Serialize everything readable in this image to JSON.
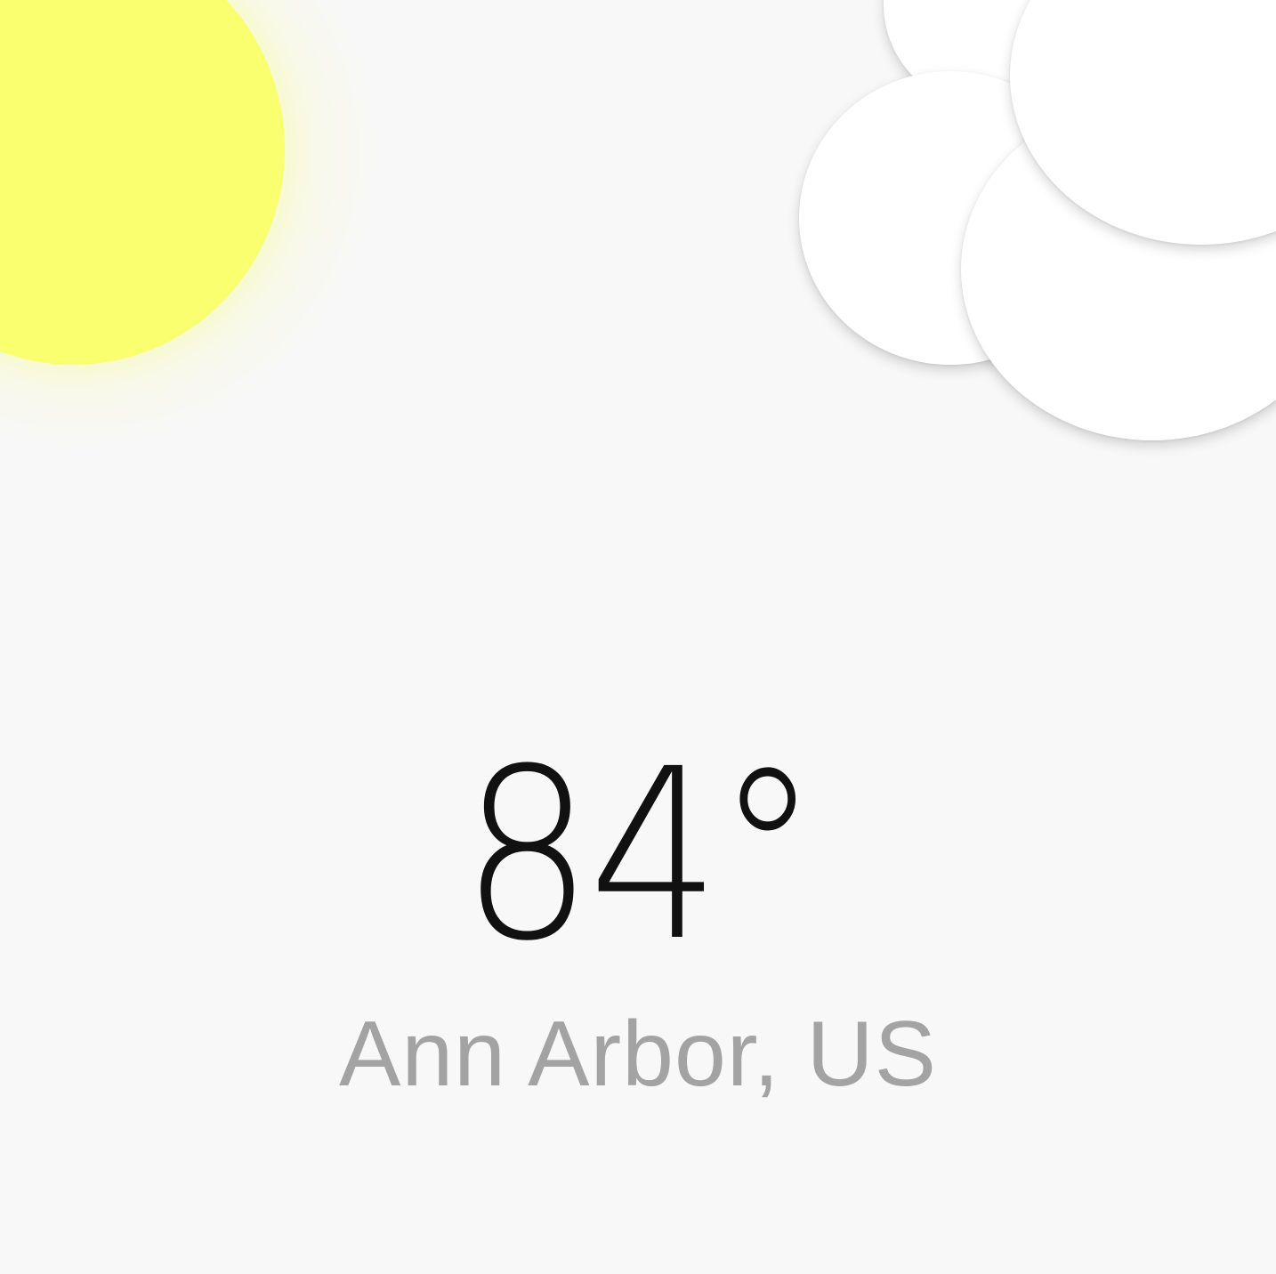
{
  "weather": {
    "temperature": "84°",
    "location": "Ann Arbor, US"
  },
  "icons": {
    "sun": "sun-icon",
    "cloud": "cloud-icon"
  },
  "colors": {
    "background": "#f8f8f8",
    "sun": "#f9ff6e",
    "cloud": "#ffffff",
    "temperature_text": "#111111",
    "location_text": "#a3a3a3"
  }
}
